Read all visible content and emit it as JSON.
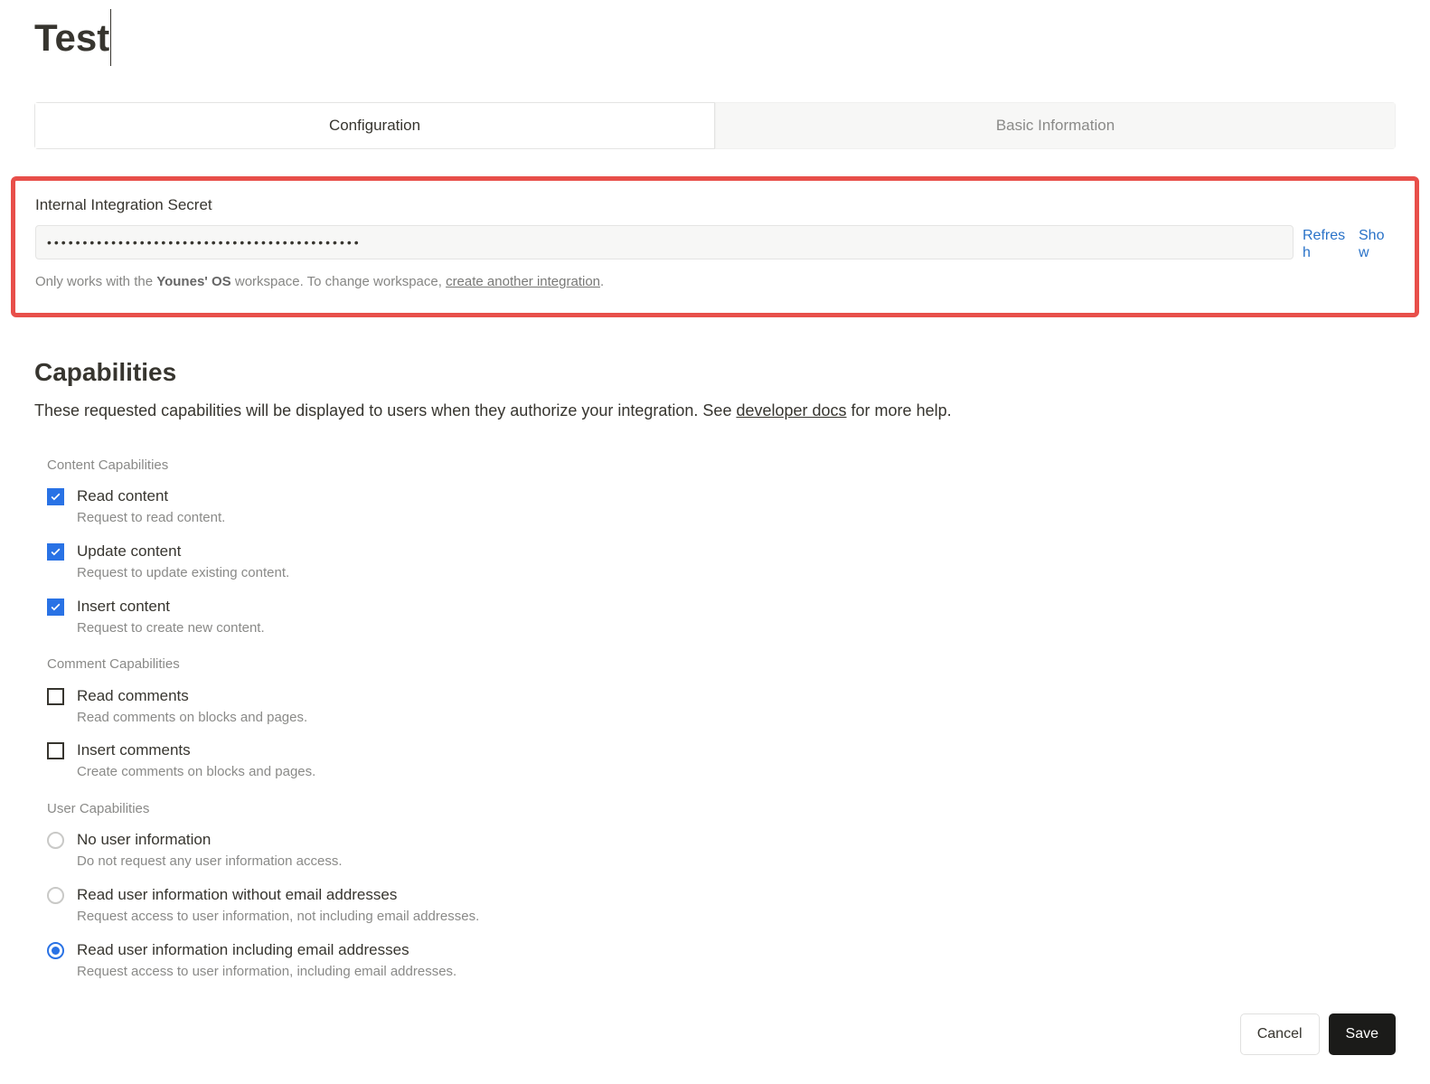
{
  "title": "Test",
  "tabs": {
    "configuration": "Configuration",
    "basic_info": "Basic Information"
  },
  "secret": {
    "label": "Internal Integration Secret",
    "masked_value": "••••••••••••••••••••••••••••••••••••••••••••",
    "refresh": "Refresh",
    "show": "Show",
    "helper_prefix": "Only works with the ",
    "helper_workspace": "Younes' OS",
    "helper_mid": " workspace. To change workspace, ",
    "helper_link": "create another integration",
    "helper_suffix": "."
  },
  "capabilities": {
    "heading": "Capabilities",
    "desc_pre": "These requested capabilities will be displayed to users when they authorize your integration. See ",
    "desc_link": "developer docs",
    "desc_post": " for more help.",
    "content_group": "Content Capabilities",
    "content": [
      {
        "label": "Read content",
        "desc": "Request to read content.",
        "checked": true
      },
      {
        "label": "Update content",
        "desc": "Request to update existing content.",
        "checked": true
      },
      {
        "label": "Insert content",
        "desc": "Request to create new content.",
        "checked": true
      }
    ],
    "comment_group": "Comment Capabilities",
    "comment": [
      {
        "label": "Read comments",
        "desc": "Read comments on blocks and pages.",
        "checked": false
      },
      {
        "label": "Insert comments",
        "desc": "Create comments on blocks and pages.",
        "checked": false
      }
    ],
    "user_group": "User Capabilities",
    "user": [
      {
        "label": "No user information",
        "desc": "Do not request any user information access.",
        "selected": false
      },
      {
        "label": "Read user information without email addresses",
        "desc": "Request access to user information, not including email addresses.",
        "selected": false
      },
      {
        "label": "Read user information including email addresses",
        "desc": "Request access to user information, including email addresses.",
        "selected": true
      }
    ]
  },
  "buttons": {
    "cancel": "Cancel",
    "save": "Save"
  }
}
